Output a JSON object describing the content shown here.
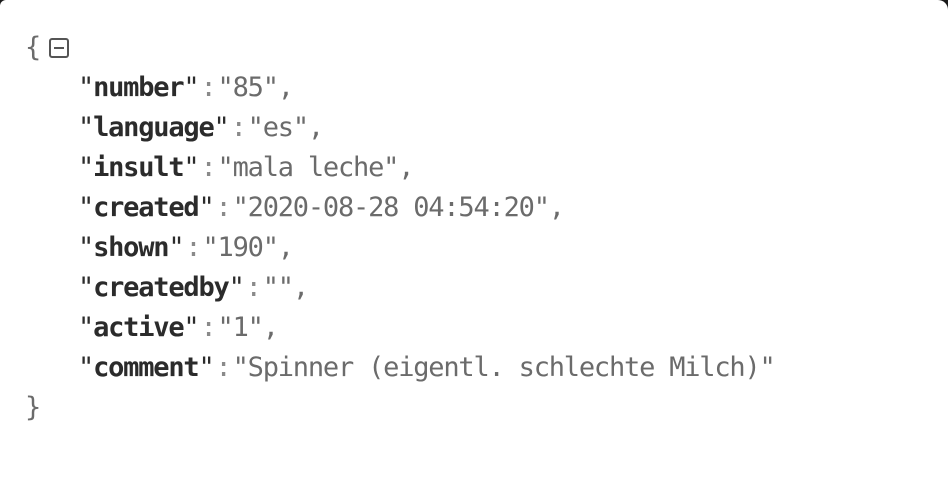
{
  "json_viewer": {
    "open_brace": "{",
    "close_brace": "}",
    "collapse_icon": "minus-square-icon",
    "entries": [
      {
        "key": "number",
        "value": "85"
      },
      {
        "key": "language",
        "value": "es"
      },
      {
        "key": "insult",
        "value": "mala leche"
      },
      {
        "key": "created",
        "value": "2020-08-28 04:54:20"
      },
      {
        "key": "shown",
        "value": "190"
      },
      {
        "key": "createdby",
        "value": ""
      },
      {
        "key": "active",
        "value": "1"
      },
      {
        "key": "comment",
        "value": "Spinner (eigentl. schlechte Milch)"
      }
    ]
  }
}
